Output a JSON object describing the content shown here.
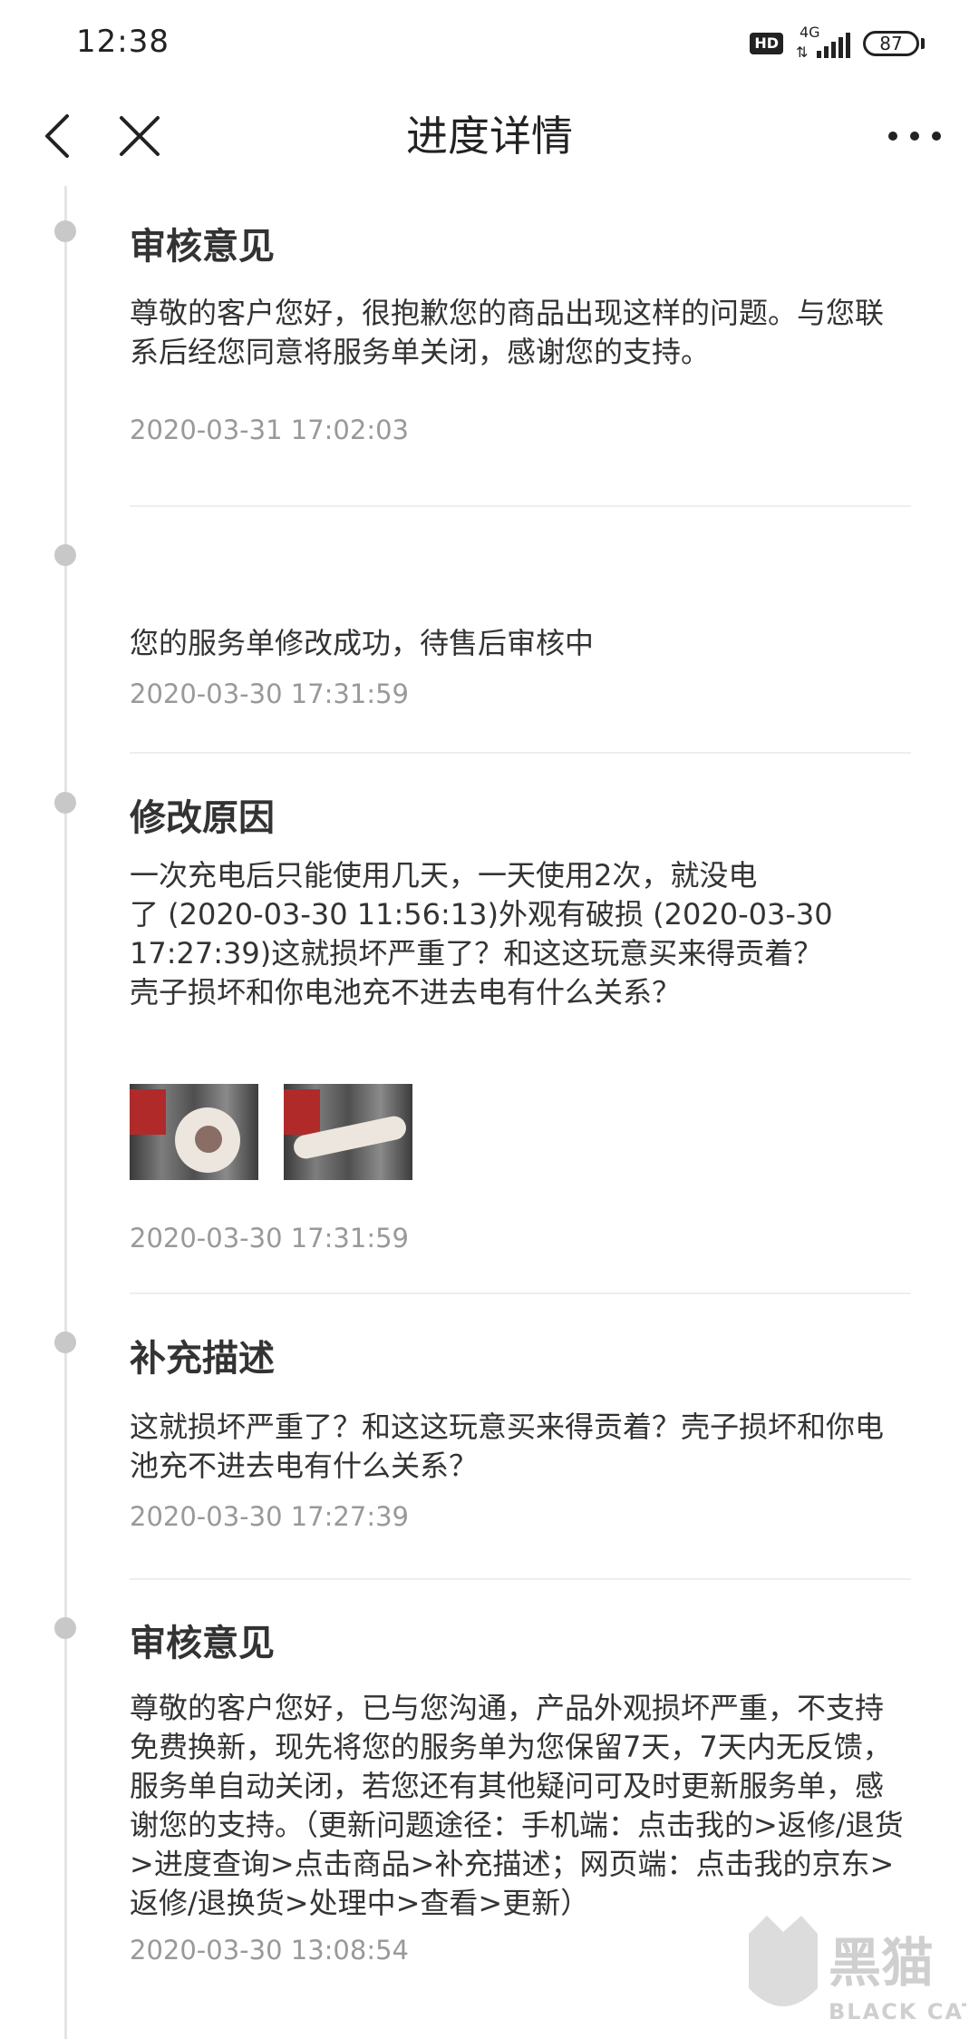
{
  "status_bar": {
    "time": "12:38",
    "hd": "HD",
    "network": "4G",
    "battery": "87"
  },
  "nav": {
    "title": "进度详情",
    "back_icon": "chevron-left-icon",
    "close_icon": "close-icon",
    "more_icon": "more-horizontal-icon"
  },
  "entries": [
    {
      "title": "审核意见",
      "text": "尊敬的客户您好，很抱歉您的商品出现这样的问题。与您联系后经您同意将服务单关闭，感谢您的支持。",
      "time": "2020-03-31 17:02:03"
    },
    {
      "title": "",
      "text": "您的服务单修改成功，待售后审核中",
      "time": "2020-03-30 17:31:59"
    },
    {
      "title": "修改原因",
      "text": "一次充电后只能使用几天，一天使用2次，就没电了 (2020-03-30 11:56:13)外观有破损 (2020-03-30 17:27:39)这就损坏严重了？和这这玩意买来得贡着？壳子损坏和你电池充不进去电有什么关系？",
      "text_lines": [
        "一次充电后只能使用几天，一天使用2次，就没电",
        "了 (2020-03-30 11:56:13)外观有破损 (2020-03-30",
        "17:27:39)这就损坏严重了？和这这玩意买来得贡着？",
        "壳子损坏和你电池充不进去电有什么关系？"
      ],
      "time": "2020-03-30 17:31:59"
    },
    {
      "title": "补充描述",
      "text": "这就损坏严重了？和这这玩意买来得贡着？壳子损坏和你电池充不进去电有什么关系？",
      "time": "2020-03-30 17:27:39"
    },
    {
      "title": "审核意见",
      "text": "尊敬的客户您好，已与您沟通，产品外观损坏严重，不支持免费换新，现先将您的服务单为您保留7天，7天内无反馈，服务单自动关闭，若您还有其他疑问可及时更新服务单，感谢您的支持。（更新问题途径：手机端：点击我的>返修/退货>进度查询>点击商品>补充描述；网页端：点击我的京东>返修/退换货>处理中>查看>更新）",
      "time": "2020-03-30 13:08:54"
    }
  ],
  "watermark": {
    "cn": "黑猫",
    "en": "BLACK CAT"
  }
}
